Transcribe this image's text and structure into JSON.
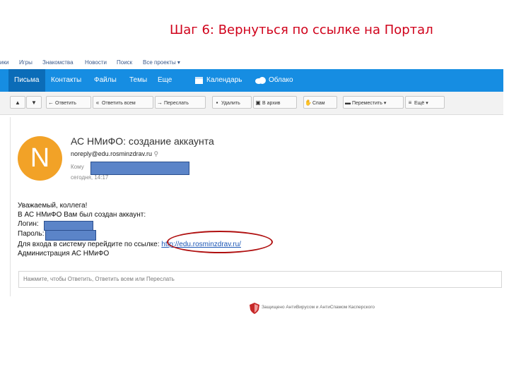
{
  "slide": {
    "title": "Шаг 6: Вернуться по ссылке на Портал"
  },
  "portal_links": [
    "ики",
    "Игры",
    "Знакомства",
    "Новости",
    "Поиск",
    "Все проекты ▾"
  ],
  "nav": {
    "items": [
      "Письма",
      "Контакты",
      "Файлы",
      "Темы",
      "Еще"
    ],
    "calendar": "Календарь",
    "cloud": "Облако"
  },
  "toolbar": {
    "reply": "Ответить",
    "reply_all": "Ответить всем",
    "forward": "Переслать",
    "delete": "Удалить",
    "archive": "В архив",
    "spam": "Спам",
    "move": "Переместить",
    "more": "Ещё"
  },
  "message": {
    "avatar_letter": "N",
    "subject": "АС НМиФО: создание аккаунта",
    "from": "noreply@edu.rosminzdrav.ru",
    "to_label": "Кому",
    "date": "сегодня, 14:17",
    "greeting": "Уважаемый, коллега!",
    "line1": "В АС НМиФО Вам был создан аккаунт:",
    "login_label": "Логин:",
    "password_label": "Пароль:",
    "link_intro": "Для входа в систему перейдите по ссылке:",
    "link": "http://edu.rosminzdrav.ru/",
    "signature": "Администрация АС НМиФО"
  },
  "reply_box": {
    "placeholder": "Нажмите, чтобы Ответить, Ответить всем или Переслать"
  },
  "footer": {
    "text": "Защищено АнтиВирусом и АнтиСпамом Касперского"
  },
  "colors": {
    "nav_blue": "#168de2",
    "title_red": "#d0021b",
    "avatar": "#f2a227",
    "redact": "#5b84c8"
  }
}
